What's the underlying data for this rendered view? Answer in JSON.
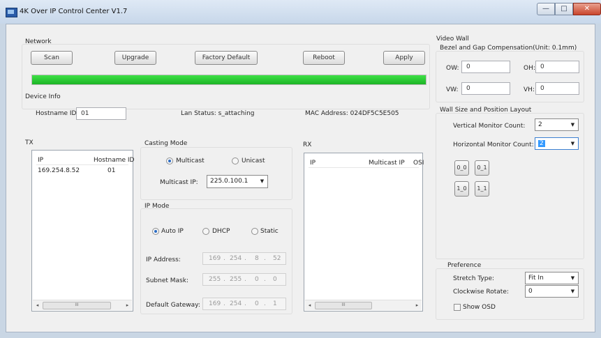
{
  "window": {
    "title": "4K Over IP Control Center V1.7",
    "min_glyph": "—",
    "max_glyph": "□",
    "close_glyph": "✕"
  },
  "network": {
    "label": "Network",
    "buttons": {
      "scan": "Scan",
      "upgrade": "Upgrade",
      "factory_default": "Factory Default",
      "reboot": "Reboot",
      "apply": "Apply"
    },
    "progress": {
      "percent": 100,
      "color": "#22c52c"
    }
  },
  "device_info": {
    "label": "Device Info",
    "hostname_label": "Hostname ID:",
    "hostname_value": "01",
    "lan_status": "Lan Status: s_attaching",
    "mac_address": "MAC Address: 024DF5C5E505"
  },
  "tx": {
    "label": "TX",
    "columns": [
      "IP",
      "Hostname ID"
    ],
    "rows": [
      {
        "ip": "169.254.8.52",
        "hostname": "01"
      }
    ],
    "scroll": {
      "left": "◂",
      "thumb": "III",
      "right": "▸"
    }
  },
  "casting_mode": {
    "label": "Casting Mode",
    "options": [
      {
        "label": "Multicast",
        "selected": true
      },
      {
        "label": "Unicast",
        "selected": false
      }
    ],
    "multicast_ip_label": "Multicast IP:",
    "multicast_ip_value": "225.0.100.1",
    "arrow": "▼"
  },
  "ip_mode": {
    "label": "IP Mode",
    "options": [
      {
        "label": "Auto IP",
        "selected": true
      },
      {
        "label": "DHCP",
        "selected": false
      },
      {
        "label": "Static",
        "selected": false
      }
    ],
    "fields": [
      {
        "label": "IP Address:",
        "octets": [
          "169",
          "254",
          "8",
          "52"
        ]
      },
      {
        "label": "Subnet Mask:",
        "octets": [
          "255",
          "255",
          "0",
          "0"
        ]
      },
      {
        "label": "Default Gateway:",
        "octets": [
          "169",
          "254",
          "0",
          "1"
        ]
      }
    ]
  },
  "rx": {
    "label": "RX",
    "columns": [
      "IP",
      "Multicast IP",
      "OSI"
    ],
    "rows": [],
    "scroll": {
      "left": "◂",
      "thumb": "III",
      "right": "▸"
    }
  },
  "video_wall": {
    "label": "Video Wall",
    "bezel_label": "Bezel and Gap Compensation(Unit: 0.1mm)",
    "fields": {
      "ow": {
        "label": "OW:",
        "value": "0"
      },
      "oh": {
        "label": "OH:",
        "value": "0"
      },
      "vw": {
        "label": "VW:",
        "value": "0"
      },
      "vh": {
        "label": "VH:",
        "value": "0"
      }
    },
    "layout_label": "Wall Size and Position Layout",
    "vertical_label": "Vertical Monitor Count:",
    "vertical_value": "2",
    "horizontal_label": "Horizontal Monitor Count:",
    "horizontal_value": "2",
    "positions": [
      "0_0",
      "0_1",
      "1_0",
      "1_1"
    ],
    "arrow": "▼"
  },
  "preference": {
    "label": "Preference",
    "stretch_label": "Stretch Type:",
    "stretch_value": "Fit In",
    "rotate_label": "Clockwise Rotate:",
    "rotate_value": "0",
    "show_osd_label": "Show OSD",
    "show_osd_checked": false,
    "arrow": "▼"
  }
}
